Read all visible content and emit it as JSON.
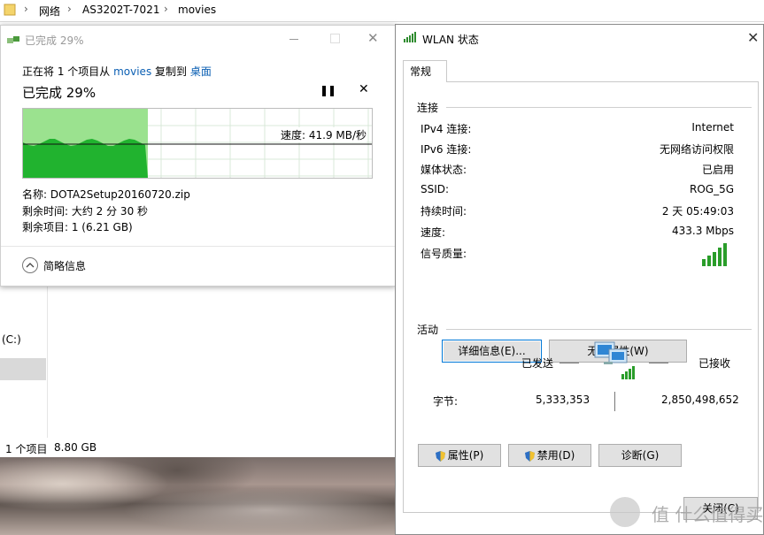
{
  "explorer": {
    "breadcrumb": [
      "网络",
      "AS3202T-7021",
      "movies"
    ],
    "drive_label": "(C:)",
    "status_count": "1 个项目",
    "status_size": "8.80 GB"
  },
  "copy_dialog": {
    "title": "已完成 29%",
    "line1_prefix": "正在将 1 个项目从 ",
    "source": "movies",
    "line1_mid": " 复制到 ",
    "destination": "桌面",
    "percent_label": "已完成 29%",
    "progress": 0.29,
    "speed_label": "速度: 41.9 MB/秒",
    "name_row": "名称:  DOTA2Setup20160720.zip",
    "time_row": "剩余时间:  大约 2 分 30 秒",
    "items_row": "剩余项目:  1 (6.21 GB)",
    "less_info": "简略信息",
    "colors": {
      "fill_light": "#9be28f",
      "fill_dark": "#21b32f",
      "grid": "#d8e8d8"
    }
  },
  "wlan": {
    "title": "WLAN 状态",
    "tab": "常规",
    "connection_title": "连接",
    "rows": [
      {
        "label": "IPv4 连接:",
        "value": "Internet"
      },
      {
        "label": "IPv6 连接:",
        "value": "无网络访问权限"
      },
      {
        "label": "媒体状态:",
        "value": "已启用"
      },
      {
        "label": "SSID:",
        "value": "ROG_5G"
      },
      {
        "label": "持续时间:",
        "value": "2 天 05:49:03"
      },
      {
        "label": "速度:",
        "value": "433.3 Mbps"
      },
      {
        "label": "信号质量:",
        "value": ""
      }
    ],
    "details_button": "详细信息(E)...",
    "wireless_button": "无线属性(W)",
    "activity_title": "活动",
    "sent_label": "已发送",
    "received_label": "已接收",
    "bytes_label": "字节:",
    "bytes_sent": "5,333,353",
    "bytes_received": "2,850,498,652",
    "properties_button": "属性(P)",
    "disable_button": "禁用(D)",
    "diagnose_button": "诊断(G)",
    "close_button": "关闭(C)"
  },
  "watermark": {
    "text": "值 什么值得买"
  }
}
